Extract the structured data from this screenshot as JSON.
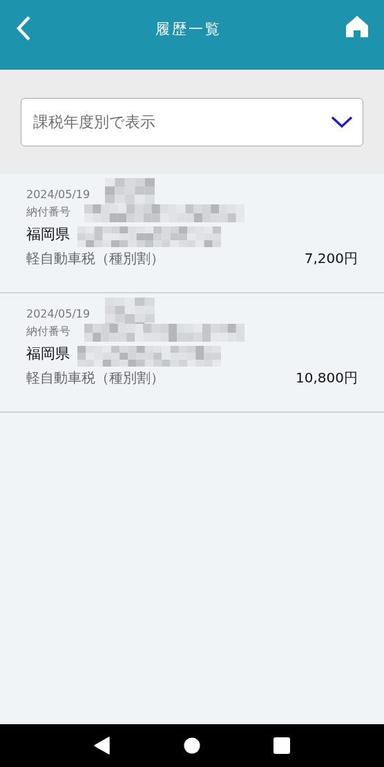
{
  "header": {
    "title": "履歴一覧"
  },
  "filter": {
    "value": "課税年度別で表示"
  },
  "history": [
    {
      "date": "2024/05/19",
      "number_label": "納付番号",
      "prefecture": "福岡県",
      "tax": "軽自動車税（種別割）",
      "amount": "7,200円"
    },
    {
      "date": "2024/05/19",
      "number_label": "納付番号",
      "prefecture": "福岡県",
      "tax": "軽自動車税（種別割）",
      "amount": "10,800円"
    }
  ]
}
